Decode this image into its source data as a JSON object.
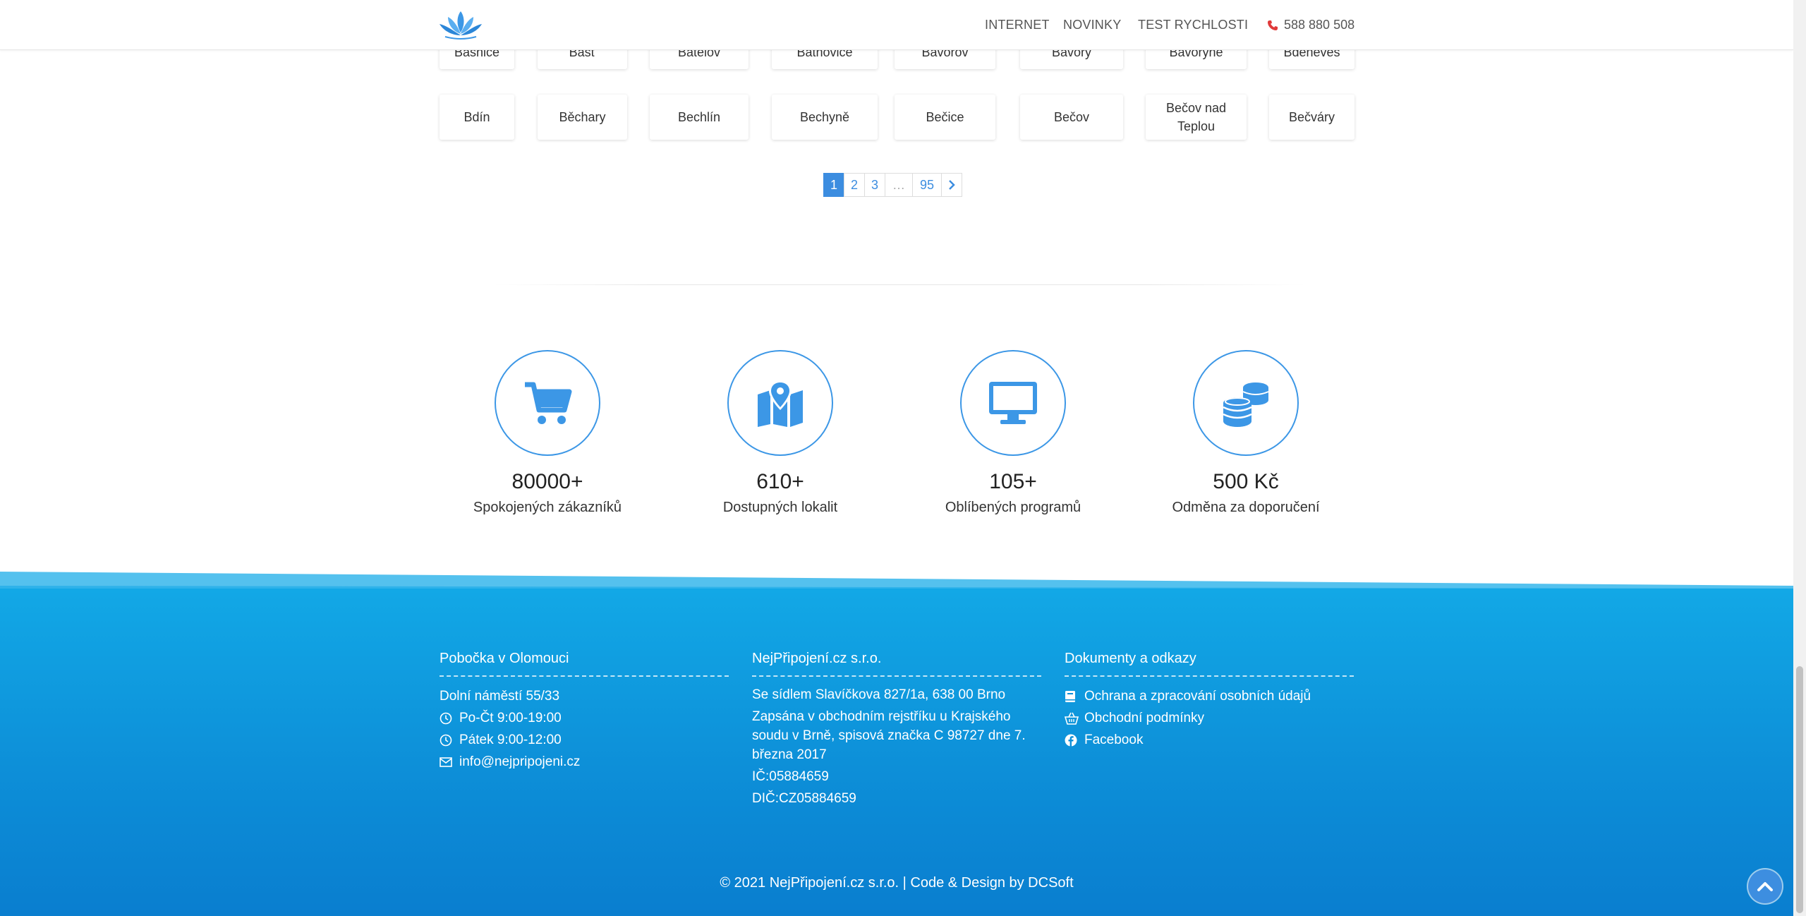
{
  "header": {
    "nav": [
      "INTERNET",
      "NOVINKY",
      "TEST RYCHLOSTI"
    ],
    "phone": "588 880 508"
  },
  "cities_row1": [
    "Bašnice",
    "Bašť",
    "Batelov",
    "Batňovice",
    "Bavorov",
    "Bavory",
    "Bavoryně",
    "Bdeněves"
  ],
  "cities_row2": [
    "Bdín",
    "Běchary",
    "Bechlín",
    "Bechyně",
    "Bečice",
    "Bečov",
    "Bečov nad Teplou",
    "Bečváry"
  ],
  "pagination": {
    "pages": [
      "1",
      "2",
      "3",
      "…",
      "95"
    ],
    "current": "1",
    "next": "›"
  },
  "stats": [
    {
      "icon": "cart-icon",
      "value": "80000+",
      "label": "Spokojených zákazníků"
    },
    {
      "icon": "map-marker-icon",
      "value": "610+",
      "label": "Dostupných lokalit"
    },
    {
      "icon": "monitor-icon",
      "value": "105+",
      "label": "Oblíbených programů"
    },
    {
      "icon": "coins-icon",
      "value": "500 Kč",
      "label": "Odměna za doporučení"
    }
  ],
  "footer": {
    "branch": {
      "title": "Pobočka v Olomouci",
      "address": "Dolní náměstí 55/33",
      "hours1": "Po-Čt 9:00-19:00",
      "hours2": "Pátek 9:00-12:00",
      "email": "info@nejpripojeni.cz"
    },
    "company": {
      "title": "NejPřipojení.cz s.r.o.",
      "seat": "Se sídlem Slavíčkova 827/1a, 638 00 Brno",
      "registry": "Zapsána v obchodním rejstříku u Krajského soudu v Brně, spisová značka C 98727 dne 7. března 2017",
      "ic": "IČ:05884659",
      "dic": "DIČ:CZ05884659"
    },
    "docs": {
      "title": "Dokumenty a odkazy",
      "privacy": "Ochrana a zpracování osobních údajů",
      "terms": "Obchodní podmínky",
      "facebook": "Facebook"
    },
    "copyright": "© 2021 NejPřipojení.cz s.r.o. | Code & Design by DCSoft"
  },
  "colors": {
    "accent": "#3c8de0",
    "footer": "#0d8fd8",
    "phone_icon": "#e03a3a"
  }
}
